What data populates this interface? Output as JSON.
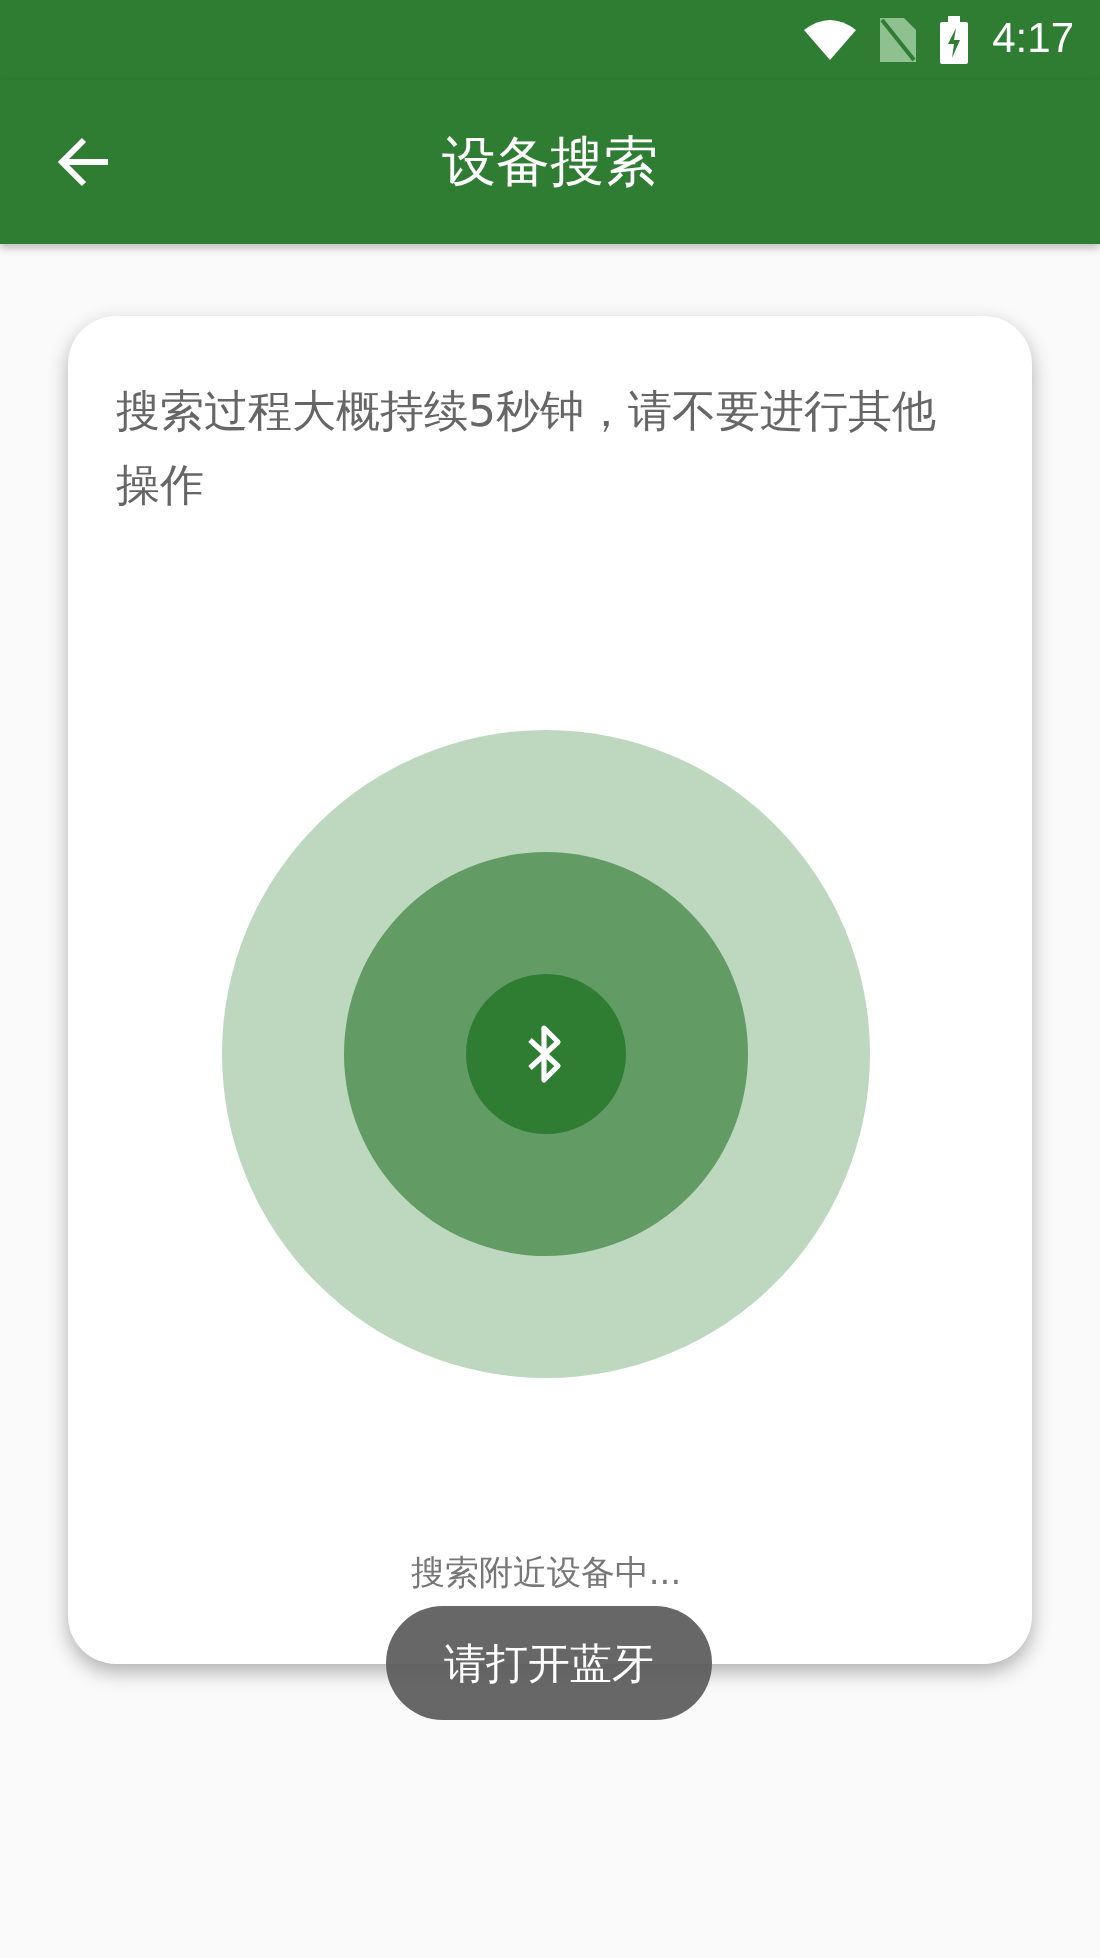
{
  "status_bar": {
    "time": "4:17"
  },
  "app_bar": {
    "title": "设备搜索"
  },
  "card": {
    "message": "搜索过程大概持续5秒钟，请不要进行其他操作",
    "status": "搜索附近设备中..."
  },
  "toast": {
    "text": "请打开蓝牙"
  }
}
